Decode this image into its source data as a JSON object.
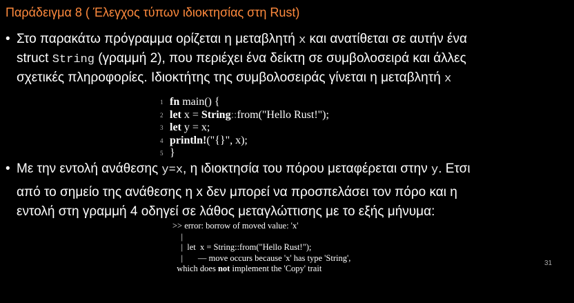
{
  "slide": {
    "title": "Παράδειγμα 8 ( Έλεγχος τύπων ιδιοκτησίας στη Rust)",
    "bullet": "•",
    "p1": {
      "l1_a": "Στο παρακάτω πρόγραμμα ορίζεται η μεταβλητή ",
      "l1_var": "x",
      "l1_b": " και ανατίθεται σε αυτήν ένα",
      "l2_a": "struct ",
      "l2_type": "String",
      "l2_b": " (γραμμή 2), που περιέχει ένα δείκτη σε συμβολοσειρά και άλλες",
      "l3_a": "σχετικές πληροφορίες. Ιδιοκτήτης της συμβολοσειράς γίνεται η μεταβλητή ",
      "l3_var": "x"
    },
    "code": [
      {
        "n": "1",
        "kw": "fn",
        "rest": " main() {"
      },
      {
        "n": "2",
        "kw": "let",
        "rest": " x = ",
        "kw2": "String",
        "sep": "::",
        "rest2": "from(\"Hello Rust!\");"
      },
      {
        "n": "3",
        "kw": "let",
        "rest": " y = x;"
      },
      {
        "n": "4",
        "kw": "println!",
        "rest": "(\"{}\", x);"
      },
      {
        "n": "5",
        "kw": "",
        "rest": "}"
      }
    ],
    "p2": {
      "l1_a": "Με την εντολή ανάθεσης ",
      "l1_code": "y=x",
      "l1_b": ", η ιδιοκτησία του πόρου μεταφέρεται στην ",
      "l1_var": "y",
      "l1_c": ". Ετσι",
      "l2": "από το σημείο της ανάθεσης η x δεν μπορεί να προσπελάσει τον πόρο και η",
      "l3": "εντολή στη γραμμή 4 οδηγεί σε λάθος μεταγλώττισης με το εξής μήνυμα:"
    },
    "error": {
      "l1": ">> error: borrow of moved value: 'x'",
      "l2": "    |",
      "l3": "    |  let  x = String::from(\"Hello Rust!\");",
      "l4": "    |       — move occurs because 'x' has type 'String',",
      "l5_a": "  which does ",
      "l5_b": "not",
      "l5_c": " implement the 'Copy' trait"
    },
    "page_number": "31"
  }
}
